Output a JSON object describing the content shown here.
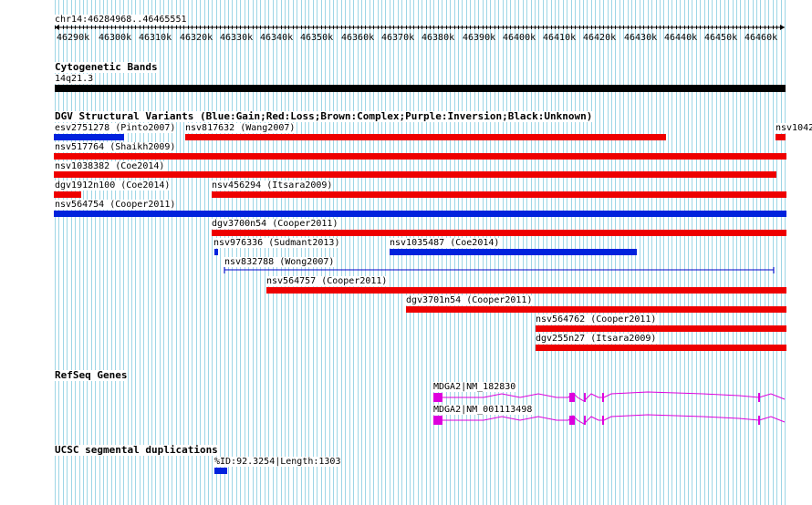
{
  "ruler": {
    "label": "chr14:46284968..46465551",
    "ticks": [
      "46290k",
      "46300k",
      "46310k",
      "46320k",
      "46330k",
      "46340k",
      "46350k",
      "46360k",
      "46370k",
      "46380k",
      "46390k",
      "46400k",
      "46410k",
      "46420k",
      "46430k",
      "46440k",
      "46450k",
      "46460k"
    ]
  },
  "tracks": {
    "cyto": {
      "title": "Cytogenetic Bands",
      "band_label": "14q21.3"
    },
    "dgv": {
      "title": "DGV Structural Variants (Blue:Gain;Red:Loss;Brown:Complex;Purple:Inversion;Black:Unknown)",
      "features": [
        {
          "label": "esv2751278 (Pinto2007)",
          "type": "gain"
        },
        {
          "label": "nsv817632 (Wang2007)",
          "type": "loss"
        },
        {
          "label": "nsv1042",
          "type": "loss"
        },
        {
          "label": "nsv517764 (Shaikh2009)",
          "type": "loss"
        },
        {
          "label": "nsv1038382 (Coe2014)",
          "type": "loss"
        },
        {
          "label": "dgv1912n100 (Coe2014)",
          "type": "loss"
        },
        {
          "label": "nsv456294 (Itsara2009)",
          "type": "loss"
        },
        {
          "label": "nsv564754 (Cooper2011)",
          "type": "gain"
        },
        {
          "label": "dgv3700n54 (Cooper2011)",
          "type": "loss"
        },
        {
          "label": "nsv976336 (Sudmant2013)",
          "type": "gain"
        },
        {
          "label": "nsv1035487 (Coe2014)",
          "type": "gain"
        },
        {
          "label": "nsv832788 (Wong2007)",
          "type": "inversion"
        },
        {
          "label": "nsv564757 (Cooper2011)",
          "type": "loss"
        },
        {
          "label": "dgv3701n54 (Cooper2011)",
          "type": "loss"
        },
        {
          "label": "nsv564762 (Cooper2011)",
          "type": "loss"
        },
        {
          "label": "dgv255n27 (Itsara2009)",
          "type": "loss"
        }
      ]
    },
    "refseq": {
      "title": "RefSeq Genes",
      "genes": [
        {
          "label": "MDGA2|NM_182830"
        },
        {
          "label": "MDGA2|NM_001113498"
        }
      ]
    },
    "segdup": {
      "title": "UCSC segmental duplications",
      "feature_label": "%ID:92.3254|Length:1303"
    }
  },
  "colors": {
    "gain": "#0022dd",
    "loss": "#ee0000",
    "inversion": "#0000cc",
    "unknown": "#000000",
    "gene": "#dd00dd",
    "grid": "#9ed6e6"
  }
}
